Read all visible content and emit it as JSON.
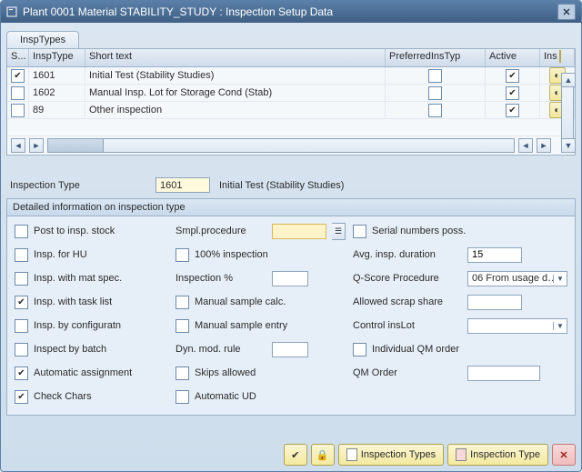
{
  "window": {
    "title": "Plant 0001 Material STABILITY_STUDY : Inspection Setup Data"
  },
  "tab": {
    "label": "InspTypes"
  },
  "table": {
    "headers": {
      "sel": "S...",
      "type": "InspType",
      "short": "Short text",
      "pref": "PreferredInsTyp",
      "active": "Active",
      "ins": "Ins"
    },
    "rows": [
      {
        "selected": true,
        "type": "1601",
        "short": "Initial Test (Stability Studies)",
        "pref": false,
        "active": true
      },
      {
        "selected": false,
        "type": "1602",
        "short": "Manual Insp. Lot for Storage Cond (Stab)",
        "pref": false,
        "active": true
      },
      {
        "selected": false,
        "type": "89",
        "short": "Other inspection",
        "pref": false,
        "active": true
      }
    ]
  },
  "selected": {
    "label": "Inspection Type",
    "code": "1601",
    "desc": "Initial Test (Stability Studies)"
  },
  "group": {
    "title": "Detailed information on inspection type"
  },
  "col1": {
    "postInspStock": {
      "label": "Post to insp. stock",
      "checked": false
    },
    "inspHU": {
      "label": "Insp. for HU",
      "checked": false
    },
    "inspMatSpec": {
      "label": "Insp. with mat spec.",
      "checked": false
    },
    "inspTaskList": {
      "label": "Insp. with task list",
      "checked": true
    },
    "inspConfig": {
      "label": "Insp. by configuratn",
      "checked": false
    },
    "inspectBatch": {
      "label": "Inspect by batch",
      "checked": false
    },
    "autoAssign": {
      "label": "Automatic assignment",
      "checked": true
    },
    "checkChars": {
      "label": "Check Chars",
      "checked": true
    }
  },
  "col2": {
    "smplProc": {
      "label": "Smpl.procedure",
      "value": ""
    },
    "insp100": {
      "label": "100% inspection",
      "checked": false
    },
    "inspPercent": {
      "label": "Inspection %",
      "value": ""
    },
    "manSampleCalc": {
      "label": "Manual sample calc.",
      "checked": false
    },
    "manSampleEntry": {
      "label": "Manual sample entry",
      "checked": false
    },
    "dynModRule": {
      "label": "Dyn. mod. rule",
      "value": ""
    },
    "skipsAllowed": {
      "label": "Skips allowed",
      "checked": false
    },
    "autoUD": {
      "label": "Automatic UD",
      "checked": false
    }
  },
  "col3": {
    "serialPoss": {
      "label": "Serial numbers poss.",
      "checked": false
    },
    "avgDur": {
      "label": "Avg. insp. duration",
      "value": "15"
    },
    "qscore": {
      "label": "Q-Score Procedure",
      "value": "06 From usage d…"
    },
    "allowedScrap": {
      "label": "Allowed scrap share",
      "value": ""
    },
    "controlInsLot": {
      "label": "Control insLot",
      "value": ""
    },
    "indivQM": {
      "label": "Individual QM order",
      "checked": false
    },
    "qmOrder": {
      "label": "QM Order",
      "value": ""
    }
  },
  "footer": {
    "types": "Inspection Types",
    "type": "Inspection Type"
  }
}
